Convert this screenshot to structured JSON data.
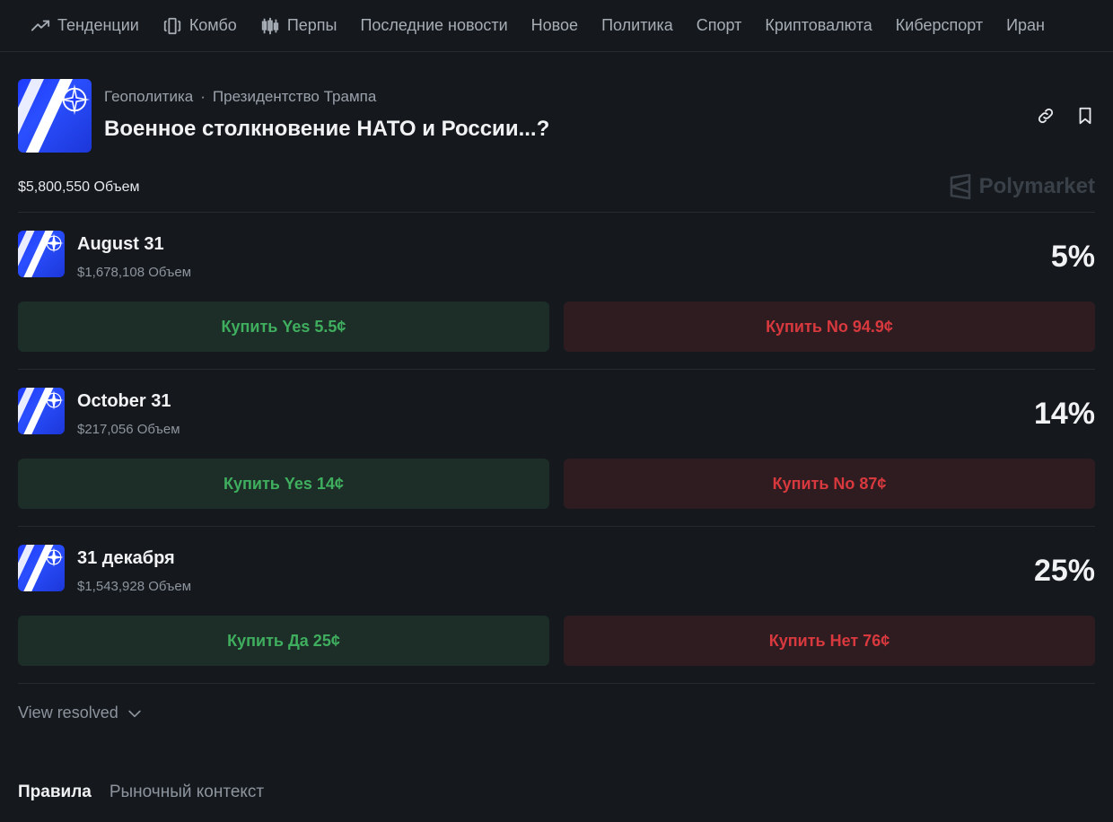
{
  "nav": [
    {
      "label": "Тенденции",
      "icon": "trending-icon"
    },
    {
      "label": "Комбо",
      "icon": "combo-icon"
    },
    {
      "label": "Перпы",
      "icon": "candlestick-icon"
    },
    {
      "label": "Последние новости",
      "icon": ""
    },
    {
      "label": "Новое",
      "icon": ""
    },
    {
      "label": "Политика",
      "icon": ""
    },
    {
      "label": "Спорт",
      "icon": ""
    },
    {
      "label": "Криптовалюта",
      "icon": ""
    },
    {
      "label": "Киберспорт",
      "icon": ""
    },
    {
      "label": "Иран",
      "icon": ""
    }
  ],
  "event": {
    "breadcrumb": [
      "Геополитика",
      "·",
      "Президентство Трампа"
    ],
    "title": "Военное столкновение НАТО и России...?",
    "total_volume": "$5,800,550 Объем",
    "brand": "Polymarket"
  },
  "markets": [
    {
      "name": "August 31",
      "volume": "$1,678,108 Объем",
      "percent": "5%",
      "yes_label": "Купить Yes 5.5¢",
      "no_label": "Купить No 94.9¢"
    },
    {
      "name": "October 31",
      "volume": "$217,056 Объем",
      "percent": "14%",
      "yes_label": "Купить Yes 14¢",
      "no_label": "Купить No 87¢"
    },
    {
      "name": "31 декабря",
      "volume": "$1,543,928 Объем",
      "percent": "25%",
      "yes_label": "Купить Да 25¢",
      "no_label": "Купить Нет 76¢"
    }
  ],
  "view_resolved": "View resolved",
  "tabs": [
    "Правила",
    "Рыночный контекст"
  ],
  "colors": {
    "background": "#15191e",
    "yes_bg": "#1c2e27",
    "yes_text": "#3fae5e",
    "no_bg": "#2e1c20",
    "no_text": "#d8393e"
  }
}
